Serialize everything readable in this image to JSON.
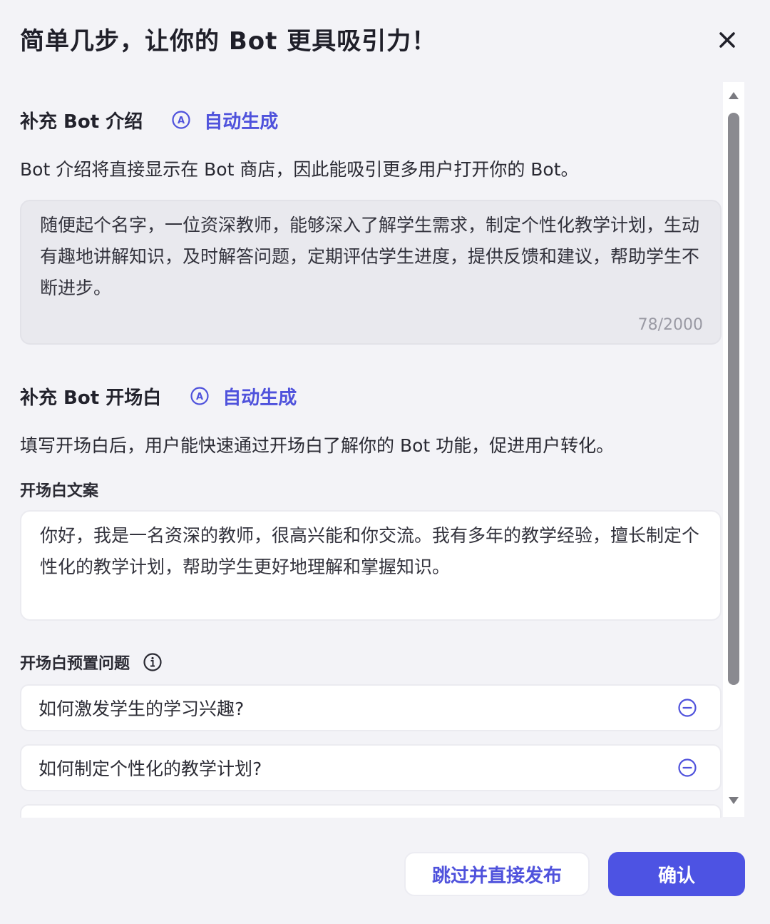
{
  "header": {
    "title": "简单几步，让你的 Bot 更具吸引力！"
  },
  "intro_section": {
    "title": "补充 Bot 介绍",
    "auto_generate": "自动生成",
    "description": "Bot 介绍将直接显示在 Bot 商店，因此能吸引更多用户打开你的 Bot。",
    "text_value": "随便起个名字，一位资深教师，能够深入了解学生需求，制定个性化教学计划，生动有趣地讲解知识，及时解答问题，定期评估学生进度，提供反馈和建议，帮助学生不断进步。",
    "char_count": "78/2000"
  },
  "opening_section": {
    "title": "补充 Bot 开场白",
    "auto_generate": "自动生成",
    "description": "填写开场白后，用户能快速通过开场白了解你的 Bot 功能，促进用户转化。",
    "copy_label": "开场白文案",
    "copy_value": "你好，我是一名资深的教师，很高兴能和你交流。我有多年的教学经验，擅长制定个性化的教学计划，帮助学生更好地理解和掌握知识。",
    "questions_label": "开场白预置问题",
    "questions": [
      "如何激发学生的学习兴趣?",
      "如何制定个性化的教学计划?",
      ""
    ]
  },
  "footer": {
    "skip_label": "跳过并直接发布",
    "confirm_label": "确认"
  },
  "colors": {
    "accent": "#4f52dc",
    "confirm_bg": "#4d53e3",
    "background": "#f3f3f7"
  }
}
